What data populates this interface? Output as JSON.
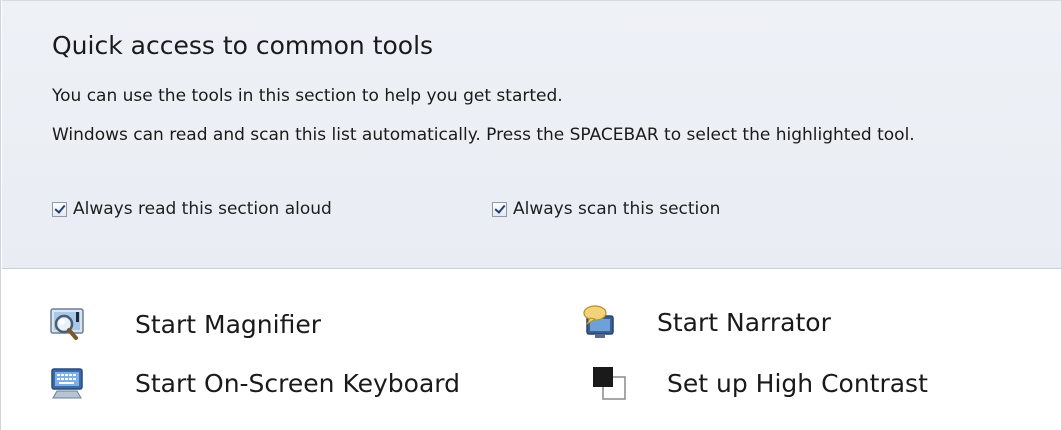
{
  "section": {
    "title": "Quick access to common tools",
    "description_1": "You can use the tools in this section to help you get started.",
    "description_2": "Windows can read and scan this list automatically.  Press the SPACEBAR to select the highlighted tool.",
    "checkboxes": [
      {
        "label": "Always read this section aloud",
        "checked": true
      },
      {
        "label": "Always scan this section",
        "checked": true
      }
    ]
  },
  "tools": {
    "magnifier": {
      "label": "Start Magnifier",
      "icon": "magnifier-icon"
    },
    "narrator": {
      "label": "Start Narrator",
      "icon": "narrator-icon"
    },
    "keyboard": {
      "label": "Start On-Screen Keyboard",
      "icon": "on-screen-keyboard-icon"
    },
    "contrast": {
      "label": "Set up High Contrast",
      "icon": "high-contrast-icon"
    }
  },
  "colors": {
    "header_background": "#eaeef4",
    "text": "#1a1a1a",
    "checkbox_check": "#1f3f73"
  }
}
